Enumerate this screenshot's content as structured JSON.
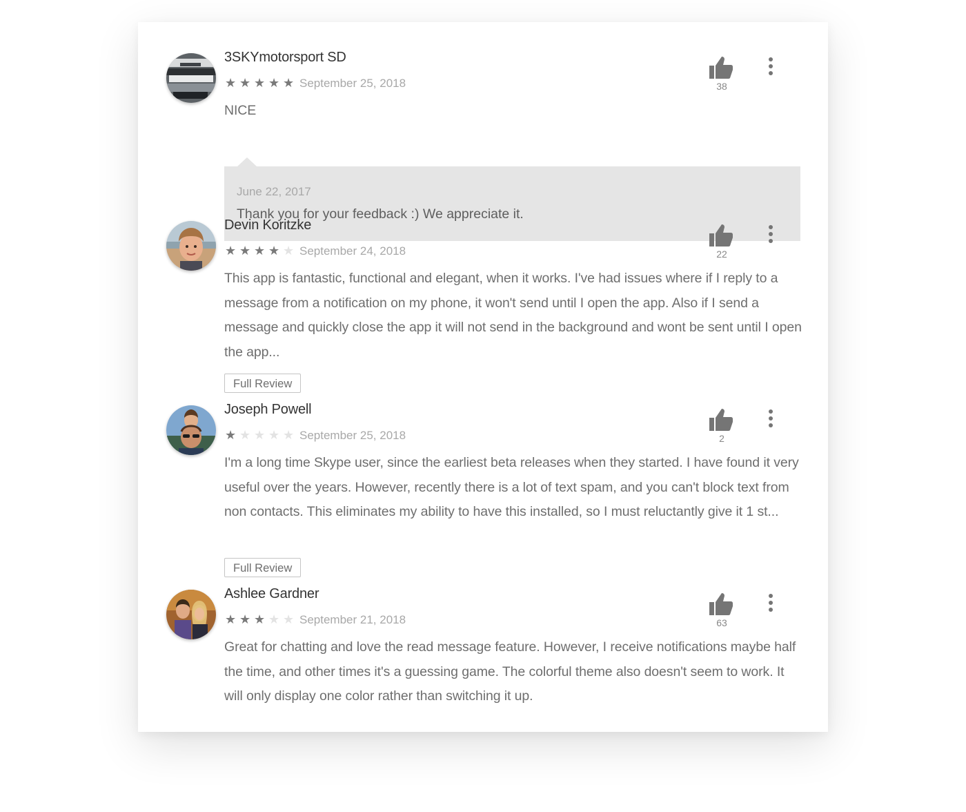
{
  "colors": {
    "star_filled": "#7a7a7a",
    "star_empty": "#e3e3e3",
    "text_body": "#6e6e6e",
    "text_meta": "#a8a8a8",
    "reply_background": "#e5e5e5",
    "icon": "#757575"
  },
  "icons": {
    "thumbs_up": "thumbs-up-icon",
    "more": "more-vertical-icon",
    "star": "star-icon"
  },
  "reviews": [
    {
      "author": "3SKYmotorsport SD",
      "rating": 5,
      "date": "September 25, 2018",
      "text": "NICE",
      "helpful_count": "38",
      "reply": {
        "date": "June 22, 2017",
        "text": "Thank you for your feedback :) We appreciate it."
      }
    },
    {
      "author": "Devin Koritzke",
      "rating": 4,
      "date": "September 24, 2018",
      "text": "This app is fantastic, functional and elegant, when it works. I've had issues where if I reply to a message from a notification on my phone, it won't send until I open the app. Also if I send a message and quickly close the app it will not send in the background and wont be sent until I open the app...",
      "helpful_count": "22",
      "full_review_label": "Full Review"
    },
    {
      "author": "Joseph Powell",
      "rating": 1,
      "date": "September 25, 2018",
      "text": "I'm a long time Skype user, since the earliest beta releases when they started. I have found it very useful over the years. However, recently there is a lot of text spam, and you can't block text from non contacts. This eliminates my ability to have this installed, so I must reluctantly give it 1 st...",
      "helpful_count": "2",
      "full_review_label": "Full Review"
    },
    {
      "author": "Ashlee Gardner",
      "rating": 3,
      "date": "September 21, 2018",
      "text": "Great for chatting and love the read message feature. However, I receive notifications maybe half the time, and other times it's a guessing game. The colorful theme also doesn't seem to work. It will only display one color rather than switching it up.",
      "helpful_count": "63"
    }
  ]
}
